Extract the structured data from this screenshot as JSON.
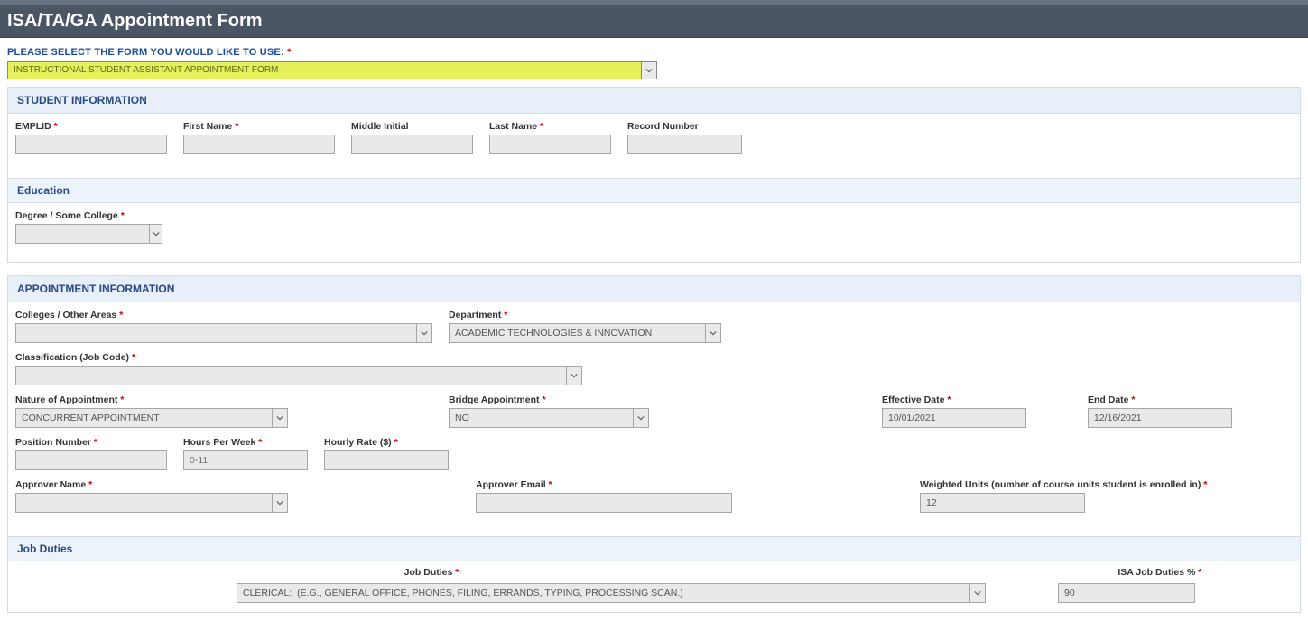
{
  "header": {
    "title": "ISA/TA/GA Appointment Form"
  },
  "formTypePrompt": "PLEASE SELECT THE FORM YOU WOULD LIKE TO USE:",
  "formTypeValue": "INSTRUCTIONAL STUDENT ASSISTANT APPOINTMENT FORM",
  "sections": {
    "student": {
      "title": "STUDENT INFORMATION",
      "fields": {
        "emplid": {
          "label": "EMPLID",
          "value": ""
        },
        "firstName": {
          "label": "First Name",
          "value": ""
        },
        "middleInitial": {
          "label": "Middle Initial",
          "value": ""
        },
        "lastName": {
          "label": "Last Name",
          "value": ""
        },
        "recordNumber": {
          "label": "Record Number",
          "value": ""
        }
      },
      "education": {
        "title": "Education",
        "degree": {
          "label": "Degree / Some College",
          "value": ""
        }
      }
    },
    "appointment": {
      "title": "APPOINTMENT INFORMATION",
      "fields": {
        "colleges": {
          "label": "Colleges / Other Areas",
          "value": ""
        },
        "department": {
          "label": "Department",
          "value": "ACADEMIC TECHNOLOGIES & INNOVATION"
        },
        "classification": {
          "label": "Classification (Job Code)",
          "value": ""
        },
        "nature": {
          "label": "Nature of Appointment",
          "value": "CONCURRENT APPOINTMENT"
        },
        "bridge": {
          "label": "Bridge Appointment",
          "value": "NO"
        },
        "effective": {
          "label": "Effective Date",
          "value": "10/01/2021"
        },
        "endDate": {
          "label": "End Date",
          "value": "12/16/2021"
        },
        "position": {
          "label": "Position Number",
          "value": ""
        },
        "hours": {
          "label": "Hours Per Week",
          "placeholder": "0-11",
          "value": ""
        },
        "rate": {
          "label": "Hourly Rate ($)",
          "value": ""
        },
        "approverName": {
          "label": "Approver Name",
          "value": ""
        },
        "approverEmail": {
          "label": "Approver Email",
          "value": ""
        },
        "weightedUnits": {
          "label": "Weighted Units (number of course units student is enrolled in)",
          "value": "12"
        }
      },
      "jobDuties": {
        "title": "Job Duties",
        "dutiesLabel": "Job Duties",
        "pctLabel": "ISA Job Duties %",
        "dutiesValue": "CLERICAL:  (E.G., GENERAL OFFICE, PHONES, FILING, ERRANDS, TYPING, PROCESSING SCAN.)",
        "pctValue": "90"
      }
    }
  }
}
